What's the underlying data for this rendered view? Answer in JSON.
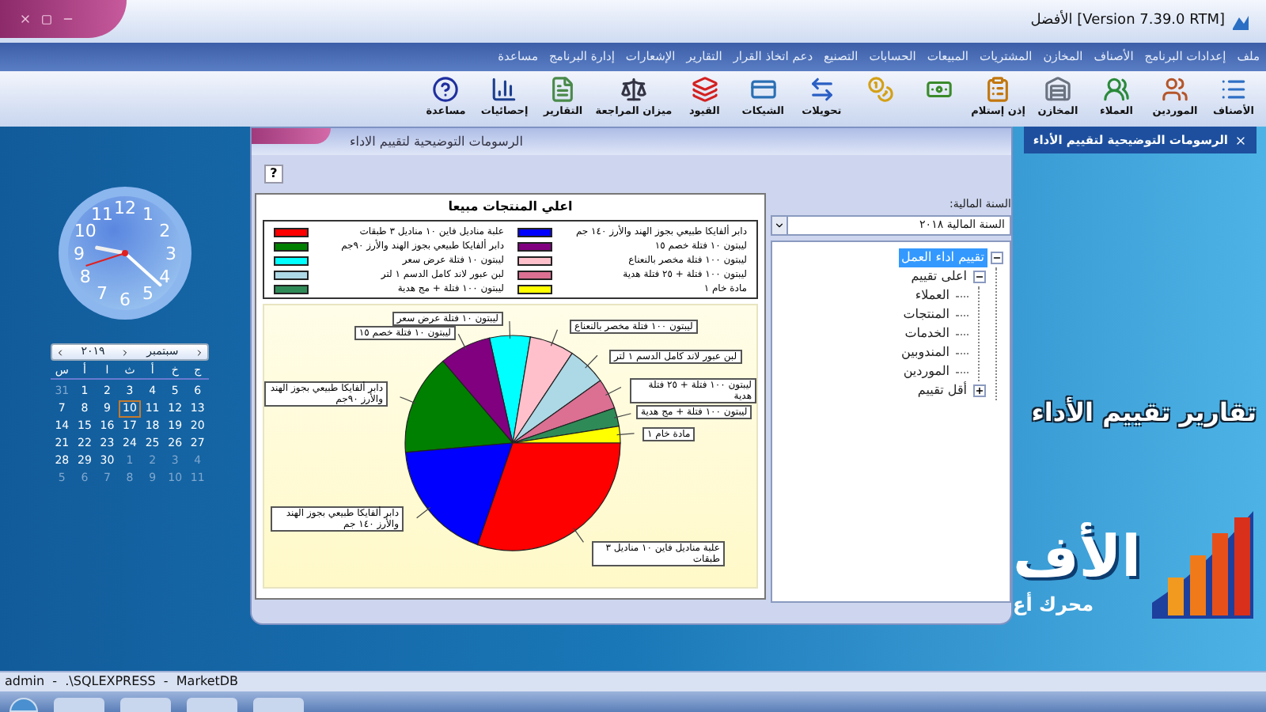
{
  "window": {
    "title": "[Version 7.39.0 RTM] الأفضل"
  },
  "menu": [
    "ملف",
    "إعدادات البرنامج",
    "الأصناف",
    "المخازن",
    "المشتريات",
    "المبيعات",
    "الحسابات",
    "التصنيع",
    "دعم اتخاذ القرار",
    "التقارير",
    "الإشعارات",
    "إدارة البرنامج",
    "مساعدة"
  ],
  "toolbar": [
    {
      "kind": "items",
      "label": "الأصناف"
    },
    {
      "kind": "suppliers",
      "label": "الموردين"
    },
    {
      "kind": "customers",
      "label": "العملاء"
    },
    {
      "kind": "stores",
      "label": "المخازن"
    },
    {
      "kind": "receipt",
      "label": "إذن إستلام"
    },
    {
      "kind": "money"
    },
    {
      "kind": "coins"
    },
    {
      "kind": "transfer",
      "label": "تحويلات"
    },
    {
      "kind": "checks",
      "label": "الشيكات"
    },
    {
      "kind": "entries",
      "label": "القيود"
    },
    {
      "kind": "balance",
      "label": "ميزان المراجعة"
    },
    {
      "kind": "reports",
      "label": "التقارير"
    },
    {
      "kind": "stats",
      "label": "إحصائيات"
    },
    {
      "kind": "help",
      "label": "مساعدة"
    }
  ],
  "tabs": [
    {
      "label": "الرسومات التوضيحية لتقييم الأداء",
      "selected": true
    }
  ],
  "panel": {
    "title": "الرسومات التوضيحية لتقييم الاداء",
    "help": "?"
  },
  "chart": {
    "title": "اعلي المنتجات مبيعا",
    "legend": [
      {
        "label": "دابر ألفايكا طبيعي بجوز الهند والأرز ١٤٠ جم",
        "color": "#0000ff"
      },
      {
        "label": "علبة مناديل فاين ١٠ مناديل ٣ طبقات",
        "color": "#ff0000"
      },
      {
        "label": "ليبتون ١٠ فتلة خصم ١٥",
        "color": "#800080"
      },
      {
        "label": "دابر ألفايكا طبيعي بجوز الهند والأرز ٩٠جم",
        "color": "#008000"
      },
      {
        "label": "ليبتون ١٠٠ فتلة مخصر بالنعناع",
        "color": "#ffc0cb"
      },
      {
        "label": "ليبتون ١٠ فتلة عرض سعر",
        "color": "#00ffff"
      },
      {
        "label": "ليبتون ١٠٠ فتلة + ٢٥ فتلة هدية",
        "color": "#db7093"
      },
      {
        "label": "لبن عبور لاند كامل الدسم ١ لتر",
        "color": "#add8e6"
      },
      {
        "label": "مادة خام ١",
        "color": "#ffff00"
      },
      {
        "label": "ليبتون ١٠٠ فتلة + مج هدية",
        "color": "#2e8b57"
      }
    ],
    "slices": [
      {
        "label": "ليبتون ١٠ فتلة عرض سعر",
        "color": "#00ffff"
      },
      {
        "label": "ليبتون ١٠٠ فتلة مخصر بالنعناع",
        "color": "#ffc0cb"
      },
      {
        "label": "ليبتون ١٠ فتلة خصم ١٥",
        "color": "#800080"
      },
      {
        "label": "لبن عبور لاند كامل الدسم ١ لتر",
        "color": "#add8e6"
      },
      {
        "label": "ليبتون ١٠٠ فتلة + ٢٥ فتلة هدية",
        "color": "#db7093"
      },
      {
        "label": "دابر ألفايكا طبيعي بجوز الهند والأرز ٩٠جم",
        "color": "#008000"
      },
      {
        "label": "ليبتون ١٠٠ فتلة + مج هدية",
        "color": "#2e8b57"
      },
      {
        "label": "مادة خام ١",
        "color": "#ffff00"
      },
      {
        "label": "دابر ألفايكا طبيعي بجوز الهند والأرز ١٤٠ جم",
        "color": "#0000ff"
      },
      {
        "label": "علبة مناديل فاين ١٠ مناديل ٣ طبقات",
        "color": "#ff0000"
      }
    ]
  },
  "fiscal_year": {
    "label": "السنة المالية:",
    "value": "السنة المالية ٢٠١٨"
  },
  "tree": [
    {
      "label": "تقييم اداء العمل",
      "selected": true,
      "expanded": true,
      "children": [
        {
          "label": "اعلى تقييم",
          "selected": false,
          "expanded": true,
          "children": [
            {
              "label": "العملاء",
              "selected": false
            },
            {
              "label": "المنتجات",
              "selected": false
            },
            {
              "label": "الخدمات",
              "selected": false
            },
            {
              "label": "المندوبين",
              "selected": false
            },
            {
              "label": "الموردين",
              "selected": false
            }
          ]
        },
        {
          "label": "أقل تقييم",
          "selected": false,
          "expanded": false
        }
      ]
    }
  ],
  "clock": {
    "numerals": [
      "1",
      "12",
      "11",
      "2",
      "10",
      "3",
      "9",
      "4",
      "8",
      "5",
      "7",
      "6"
    ]
  },
  "calendar": {
    "month": "سبتمبر",
    "year": "٢٠١٩",
    "weekdays": [
      "ج",
      "خ",
      "أ",
      "ث",
      "ا",
      "أ",
      "س"
    ],
    "days": [
      {
        "day": "6",
        "other_month": false,
        "selected": false
      },
      {
        "day": "5",
        "other_month": false,
        "selected": false
      },
      {
        "day": "4",
        "other_month": false,
        "selected": false
      },
      {
        "day": "3",
        "other_month": false,
        "selected": false
      },
      {
        "day": "2",
        "other_month": false,
        "selected": false
      },
      {
        "day": "1",
        "other_month": false,
        "selected": false
      },
      {
        "day": "31",
        "other_month": true,
        "selected": false
      },
      {
        "day": "13",
        "other_month": false,
        "selected": false
      },
      {
        "day": "12",
        "other_month": false,
        "selected": false
      },
      {
        "day": "11",
        "other_month": false,
        "selected": false
      },
      {
        "day": "10",
        "other_month": false,
        "selected": true
      },
      {
        "day": "9",
        "other_month": false,
        "selected": false
      },
      {
        "day": "8",
        "other_month": false,
        "selected": false
      },
      {
        "day": "7",
        "other_month": false,
        "selected": false
      },
      {
        "day": "20",
        "other_month": false,
        "selected": false
      },
      {
        "day": "19",
        "other_month": false,
        "selected": false
      },
      {
        "day": "18",
        "other_month": false,
        "selected": false
      },
      {
        "day": "17",
        "other_month": false,
        "selected": false
      },
      {
        "day": "16",
        "other_month": false,
        "selected": false
      },
      {
        "day": "15",
        "other_month": false,
        "selected": false
      },
      {
        "day": "14",
        "other_month": false,
        "selected": false
      },
      {
        "day": "27",
        "other_month": false,
        "selected": false
      },
      {
        "day": "26",
        "other_month": false,
        "selected": false
      },
      {
        "day": "25",
        "other_month": false,
        "selected": false
      },
      {
        "day": "24",
        "other_month": false,
        "selected": false
      },
      {
        "day": "23",
        "other_month": false,
        "selected": false
      },
      {
        "day": "22",
        "other_month": false,
        "selected": false
      },
      {
        "day": "21",
        "other_month": false,
        "selected": false
      },
      {
        "day": "4",
        "other_month": true,
        "selected": false
      },
      {
        "day": "3",
        "other_month": true,
        "selected": false
      },
      {
        "day": "2",
        "other_month": true,
        "selected": false
      },
      {
        "day": "1",
        "other_month": true,
        "selected": false
      },
      {
        "day": "30",
        "other_month": false,
        "selected": false
      },
      {
        "day": "29",
        "other_month": false,
        "selected": false
      },
      {
        "day": "28",
        "other_month": false,
        "selected": false
      },
      {
        "day": "11",
        "other_month": true,
        "selected": false
      },
      {
        "day": "10",
        "other_month": true,
        "selected": false
      },
      {
        "day": "9",
        "other_month": true,
        "selected": false
      },
      {
        "day": "8",
        "other_month": true,
        "selected": false
      },
      {
        "day": "7",
        "other_month": true,
        "selected": false
      },
      {
        "day": "6",
        "other_month": true,
        "selected": false
      },
      {
        "day": "5",
        "other_month": true,
        "selected": false
      }
    ]
  },
  "banner": {
    "title": "تقارير تقييم الأداء",
    "logo_text": "الأف",
    "tagline": "محرك أع"
  },
  "status_bar": "admin  -  .\\SQLEXPRESS  -  MarketDB"
}
